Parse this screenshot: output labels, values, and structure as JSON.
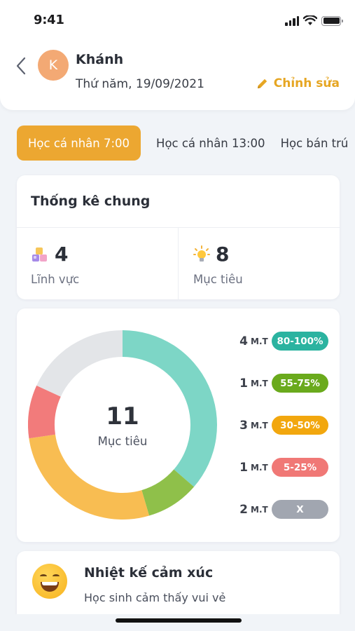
{
  "status_bar": {
    "time": "9:41"
  },
  "header": {
    "avatar_letter": "K",
    "name": "Khánh",
    "date": "Thứ năm, 19/09/2021",
    "edit_label": "Chỉnh sửa"
  },
  "tabs": [
    {
      "label": "Học cá nhân 7:00",
      "active": true
    },
    {
      "label": "Học cá nhân 13:00",
      "active": false
    },
    {
      "label": "Học bán trú",
      "active": false
    }
  ],
  "summary": {
    "title": "Thống kê chung",
    "fields_count": "4",
    "fields_label": "Lĩnh vực",
    "goals_count": "8",
    "goals_label": "Mục tiêu"
  },
  "chart_data": {
    "type": "pie",
    "center_value": "11",
    "center_label": "Mục tiêu",
    "unit_label": "M.T",
    "categories": [
      "80-100%",
      "55-75%",
      "30-50%",
      "5-25%",
      "X"
    ],
    "values": [
      4,
      1,
      3,
      1,
      2
    ],
    "colors": [
      "#7dd6c6",
      "#8fc04a",
      "#f8bd52",
      "#f27b7b",
      "#e3e5e8"
    ],
    "pill_colors": [
      "#2bb3a0",
      "#6aaa1c",
      "#f2a70e",
      "#f07876",
      "#a1a6b0"
    ]
  },
  "emotion": {
    "title": "Nhiệt kế cảm xúc",
    "subtitle": "Học sinh cảm thấy vui vẻ"
  }
}
